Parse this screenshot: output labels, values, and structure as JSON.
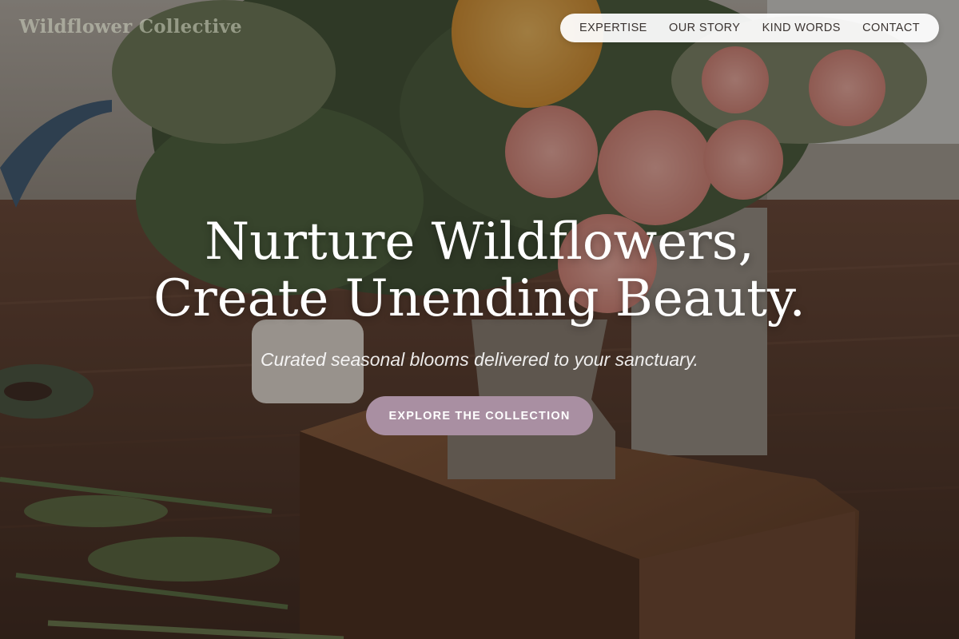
{
  "brand": {
    "name": "Wildflower Collective"
  },
  "nav": {
    "items": [
      {
        "label": "EXPERTISE"
      },
      {
        "label": "OUR STORY"
      },
      {
        "label": "KIND WORDS"
      },
      {
        "label": "CONTACT"
      }
    ]
  },
  "hero": {
    "headline_line1": "Nurture Wildflowers,",
    "headline_line2": "Create Unending Beauty.",
    "tagline": "Curated seasonal blooms delivered to your sanctuary.",
    "cta_label": "EXPLORE THE COLLECTION",
    "background_image": "flower-arrangement-on-wooden-box-photo"
  },
  "colors": {
    "cta_background": "#a98fa2",
    "nav_background": "#ffffff",
    "nav_text": "#3a3330",
    "headline_text": "#ffffff"
  }
}
